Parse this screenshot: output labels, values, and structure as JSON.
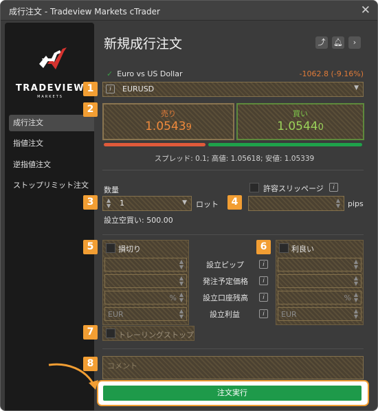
{
  "window": {
    "title": "成行注文 - Tradeview Markets cTrader",
    "close_icon": "close-icon"
  },
  "logo": {
    "brand": "TRADEVIEW",
    "sub": "MARKETS"
  },
  "sidebar": {
    "items": [
      {
        "label": "成行注文",
        "active": true
      },
      {
        "label": "指値注文",
        "active": false
      },
      {
        "label": "逆指値注文",
        "active": false
      },
      {
        "label": "ストップリミット注文",
        "active": false
      }
    ]
  },
  "header": {
    "title": "新規成行注文",
    "icons": [
      "share-icon",
      "bell-icon",
      "chevron-right-icon"
    ]
  },
  "symbol": {
    "name": "Euro vs US Dollar",
    "change": "-1062.8 (-9.16%)",
    "selected": "EURUSD",
    "info": "i"
  },
  "quote": {
    "sell_label": "売り",
    "sell_price_main": "1.0543",
    "sell_price_last": "9",
    "buy_label": "買い",
    "buy_price_main": "1.0544",
    "buy_price_last": "0",
    "spread_text": "スプレッド: 0.1; 高値: 1.05618; 安値: 1.05339",
    "sell_share": 0.4,
    "sell_color": "#e05a3a",
    "buy_color": "#1ea24a"
  },
  "volume": {
    "label": "数量",
    "value": "1",
    "unit": "ロット",
    "available": "設立空買い: 500.00"
  },
  "slippage": {
    "label": "許容スリッページ",
    "info": "i",
    "value": "",
    "unit": "pips"
  },
  "stop_loss": {
    "label": "損切り",
    "unit_percent": "%",
    "currency": "EUR"
  },
  "take_profit": {
    "label": "利良い",
    "unit_percent": "%",
    "currency": "EUR"
  },
  "middle_labels": {
    "pips": "設立ピップ",
    "price": "発注予定価格",
    "balance": "設立口座残高",
    "profit": "設立利益",
    "info": "i"
  },
  "trailing": {
    "label": "トレーリングストップ"
  },
  "comment": {
    "placeholder": "コメント"
  },
  "submit": {
    "label": "注文実行",
    "color": "#1e9a4a"
  },
  "badges": [
    "1",
    "2",
    "3",
    "4",
    "5",
    "6",
    "7",
    "8"
  ],
  "accent": "#f29e33"
}
